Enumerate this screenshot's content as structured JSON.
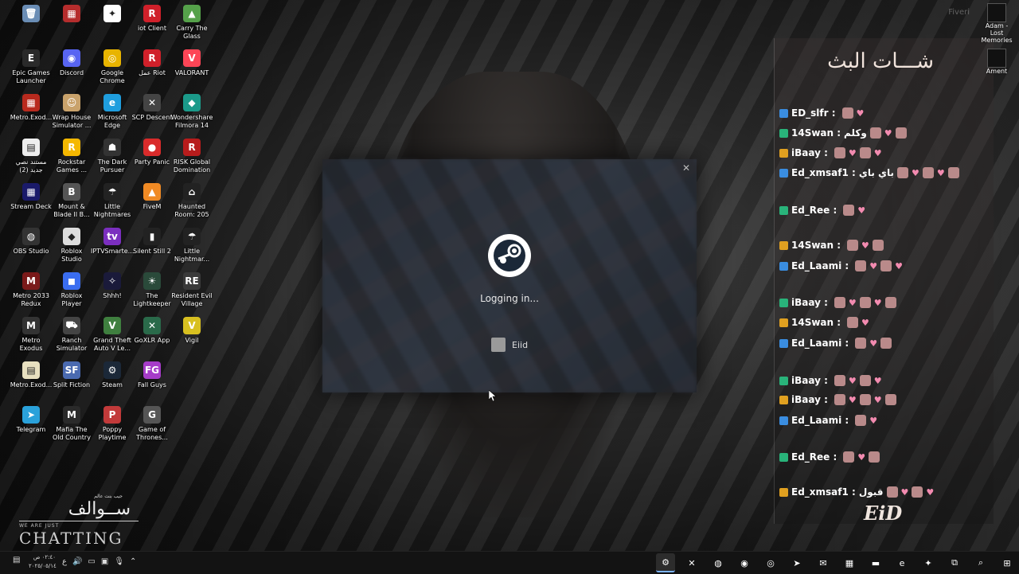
{
  "desktop": {
    "icons": [
      {
        "label": "",
        "color": "#6a8db5",
        "glyph": "🗑"
      },
      {
        "label": "",
        "color": "#b52d2d",
        "glyph": "▦"
      },
      {
        "label": "",
        "color": "#ffffff",
        "glyph": "✦"
      },
      {
        "label": "iot Client",
        "color": "#d0202a",
        "glyph": "R"
      },
      {
        "label": "Carry The Glass",
        "color": "#55a14a",
        "glyph": "▲"
      },
      {
        "label": "Epic Games Launcher",
        "color": "#2a2a2a",
        "glyph": "E"
      },
      {
        "label": "Discord",
        "color": "#5865f2",
        "glyph": "◉"
      },
      {
        "label": "Google Chrome",
        "color": "#e8b400",
        "glyph": "◎"
      },
      {
        "label": "عمل Riot",
        "color": "#d0202a",
        "glyph": "R"
      },
      {
        "label": "VALORANT",
        "color": "#fd4556",
        "glyph": "V"
      },
      {
        "label": "Metro.Exod...",
        "color": "#b82a1e",
        "glyph": "▦"
      },
      {
        "label": "Wrap House Simulator ...",
        "color": "#c9a26b",
        "glyph": "☺"
      },
      {
        "label": "Microsoft Edge",
        "color": "#1f9ede",
        "glyph": "e"
      },
      {
        "label": "SCP Descent",
        "color": "#444444",
        "glyph": "✕"
      },
      {
        "label": "Wondershare Filmora 14",
        "color": "#1b9a8a",
        "glyph": "◆"
      },
      {
        "label": "مستند نصي جديد (2)",
        "color": "#eeeeee",
        "glyph": "▤"
      },
      {
        "label": "Rockstar Games ...",
        "color": "#f5b800",
        "glyph": "R"
      },
      {
        "label": "The Dark Pursuer",
        "color": "#333333",
        "glyph": "☗"
      },
      {
        "label": "Party Panic",
        "color": "#d92b2b",
        "glyph": "●"
      },
      {
        "label": "RISK Global Domination",
        "color": "#b71c1c",
        "glyph": "R"
      },
      {
        "label": "Stream Deck",
        "color": "#1a1a6a",
        "glyph": "▦"
      },
      {
        "label": "Mount & Blade II B...",
        "color": "#555555",
        "glyph": "B"
      },
      {
        "label": "Little Nightmares",
        "color": "#222222",
        "glyph": "☂"
      },
      {
        "label": "FiveM",
        "color": "#f08a24",
        "glyph": "▲"
      },
      {
        "label": "Haunted Room: 205",
        "color": "#222222",
        "glyph": "⌂"
      },
      {
        "label": "OBS Studio",
        "color": "#333333",
        "glyph": "◍"
      },
      {
        "label": "Roblox Studio",
        "color": "#dddddd",
        "glyph": "◆"
      },
      {
        "label": "IPTVSmarte...",
        "color": "#7b2fbf",
        "glyph": "tv"
      },
      {
        "label": "Silent Still 2",
        "color": "#222222",
        "glyph": "▮"
      },
      {
        "label": "Little Nightmar...",
        "color": "#222222",
        "glyph": "☂"
      },
      {
        "label": "Metro 2033 Redux",
        "color": "#7a1a1a",
        "glyph": "M"
      },
      {
        "label": "Roblox Player",
        "color": "#3a6df0",
        "glyph": "◼"
      },
      {
        "label": "Shhh!",
        "color": "#1a1a3a",
        "glyph": "✧"
      },
      {
        "label": "The Lightkeeper",
        "color": "#2a4a3a",
        "glyph": "☀"
      },
      {
        "label": "Resident Evil Village",
        "color": "#3a3a3a",
        "glyph": "RE"
      },
      {
        "label": "Metro Exodus",
        "color": "#333333",
        "glyph": "M"
      },
      {
        "label": "Ranch Simulator",
        "color": "#444444",
        "glyph": "⛟"
      },
      {
        "label": "Grand Theft Auto V Le...",
        "color": "#3f7f3f",
        "glyph": "V"
      },
      {
        "label": "GoXLR App",
        "color": "#2a6a4a",
        "glyph": "✕"
      },
      {
        "label": "Vigil",
        "color": "#d8c020",
        "glyph": "V"
      },
      {
        "label": "Metro.Exod...",
        "color": "#e8e0c0",
        "glyph": "▤"
      },
      {
        "label": "Split Fiction",
        "color": "#4a6ab0",
        "glyph": "SF"
      },
      {
        "label": "Steam",
        "color": "#1b2838",
        "glyph": "⚙"
      },
      {
        "label": "Fall Guys",
        "color": "#a63cc8",
        "glyph": "FG"
      },
      {
        "label": "",
        "color": "#000000",
        "glyph": ""
      },
      {
        "label": "Telegram",
        "color": "#2aa1da",
        "glyph": "➤"
      },
      {
        "label": "Mafia The Old Country",
        "color": "#2a2a2a",
        "glyph": "M"
      },
      {
        "label": "Poppy Playtime",
        "color": "#c23a3a",
        "glyph": "P"
      },
      {
        "label": "Game of Thrones...",
        "color": "#555555",
        "glyph": "G"
      }
    ]
  },
  "dialog": {
    "status_text": "Logging in...",
    "account_name": "Eiid",
    "close_glyph": "✕"
  },
  "top_right": {
    "faint_label": "Fiveri",
    "items": [
      {
        "label": "Adam - Lost Memories"
      },
      {
        "label": "Ament"
      }
    ]
  },
  "chat": {
    "title": "شـــات البث",
    "logo": "EiD",
    "lines": [
      {
        "user": "ED_slfr :",
        "text": ""
      },
      {
        "user": "14Swan :",
        "text": "وكلم"
      },
      {
        "user": "iBaay :",
        "text": ""
      },
      {
        "user": "Ed_xmsaf1 :",
        "text": "باي باي"
      },
      {
        "user": "Ed_Ree :",
        "text": ""
      },
      {
        "user": "14Swan :",
        "text": ""
      },
      {
        "user": "Ed_Laami :",
        "text": ""
      },
      {
        "user": "iBaay :",
        "text": ""
      },
      {
        "user": "14Swan :",
        "text": ""
      },
      {
        "user": "Ed_Laami :",
        "text": ""
      },
      {
        "user": "iBaay :",
        "text": ""
      },
      {
        "user": "iBaay :",
        "text": ""
      },
      {
        "user": "Ed_Laami :",
        "text": ""
      },
      {
        "user": "Ed_Ree :",
        "text": ""
      },
      {
        "user": "Ed_xmsaf1 :",
        "text": "قبول"
      }
    ]
  },
  "watermark": {
    "small": "جيب بنت عالم",
    "arabic": "ســوالف",
    "tiny": "WE ARE JUST",
    "big": "CHATTING"
  },
  "taskbar": {
    "clock_time": "٠٢:٤٠ ص",
    "clock_date": "٢٠٢٥/٠٥/١٤",
    "lang": "ع",
    "apps": [
      {
        "name": "steam",
        "glyph": "⚙",
        "color": "#1b2838"
      },
      {
        "name": "xbox",
        "glyph": "✕",
        "color": "#2a2a2a"
      },
      {
        "name": "obs",
        "glyph": "◍",
        "color": "#2a2a2a"
      },
      {
        "name": "discord",
        "glyph": "◉",
        "color": "#5865f2"
      },
      {
        "name": "chrome",
        "glyph": "◎",
        "color": "#e8b400"
      },
      {
        "name": "telegram",
        "glyph": "➤",
        "color": "#2aa1da"
      },
      {
        "name": "outlook",
        "glyph": "✉",
        "color": "#1a73c8"
      },
      {
        "name": "store",
        "glyph": "▦",
        "color": "#2a6acb"
      },
      {
        "name": "explorer",
        "glyph": "▬",
        "color": "#e8b84a"
      },
      {
        "name": "edge",
        "glyph": "e",
        "color": "#1f9ede"
      },
      {
        "name": "copilot",
        "glyph": "✦",
        "color": "#6a5acd"
      },
      {
        "name": "task-view",
        "glyph": "⧉",
        "color": "#2a2a2a"
      },
      {
        "name": "search",
        "glyph": "⌕",
        "color": "#2a2a2a"
      },
      {
        "name": "start",
        "glyph": "⊞",
        "color": "#2a2a2a"
      }
    ]
  }
}
